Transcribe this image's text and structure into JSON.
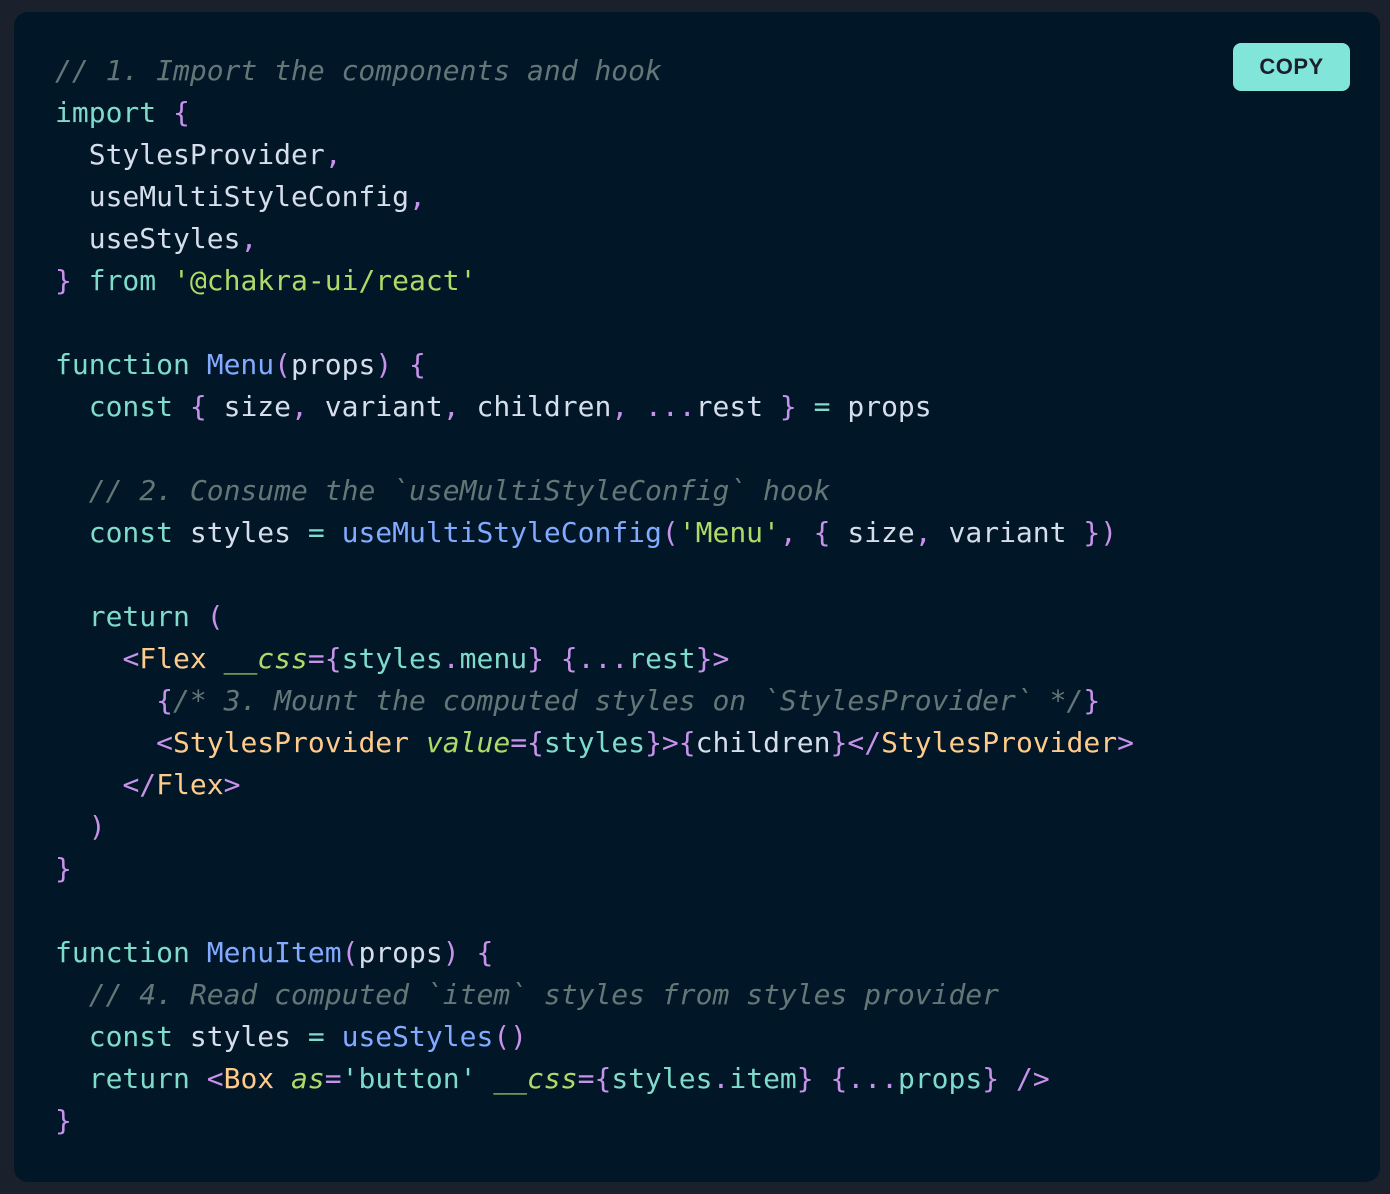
{
  "copy_button": {
    "label": "COPY"
  },
  "colors": {
    "background": "#011627",
    "comment": "#637777",
    "keyword": "#7fdbca",
    "punctuation": "#c792ea",
    "plain": "#d6deeb",
    "string": "#addb67",
    "function": "#82aaff",
    "tag": "#ffcb8b",
    "button": "#81e6d9"
  },
  "code_lines": [
    [
      [
        "comment",
        "// 1. Import the components and hook"
      ]
    ],
    [
      [
        "keyword",
        "import"
      ],
      [
        "plain",
        " "
      ],
      [
        "punct",
        "{"
      ]
    ],
    [
      [
        "plain",
        "  StylesProvider"
      ],
      [
        "punct",
        ","
      ]
    ],
    [
      [
        "plain",
        "  useMultiStyleConfig"
      ],
      [
        "punct",
        ","
      ]
    ],
    [
      [
        "plain",
        "  useStyles"
      ],
      [
        "punct",
        ","
      ]
    ],
    [
      [
        "punct",
        "}"
      ],
      [
        "plain",
        " "
      ],
      [
        "keyword",
        "from"
      ],
      [
        "plain",
        " "
      ],
      [
        "string",
        "'@chakra-ui/react'"
      ]
    ],
    [],
    [
      [
        "keyword",
        "function"
      ],
      [
        "plain",
        " "
      ],
      [
        "fn",
        "Menu"
      ],
      [
        "punct",
        "("
      ],
      [
        "plain",
        "props"
      ],
      [
        "punct",
        ")"
      ],
      [
        "plain",
        " "
      ],
      [
        "punct",
        "{"
      ]
    ],
    [
      [
        "plain",
        "  "
      ],
      [
        "keyword",
        "const"
      ],
      [
        "plain",
        " "
      ],
      [
        "punct",
        "{"
      ],
      [
        "plain",
        " size"
      ],
      [
        "punct",
        ","
      ],
      [
        "plain",
        " variant"
      ],
      [
        "punct",
        ","
      ],
      [
        "plain",
        " children"
      ],
      [
        "punct",
        ","
      ],
      [
        "plain",
        " "
      ],
      [
        "punct",
        "..."
      ],
      [
        "plain",
        "rest "
      ],
      [
        "punct",
        "}"
      ],
      [
        "plain",
        " "
      ],
      [
        "keyword",
        "="
      ],
      [
        "plain",
        " props"
      ]
    ],
    [],
    [
      [
        "plain",
        "  "
      ],
      [
        "comment",
        "// 2. Consume the `useMultiStyleConfig` hook"
      ]
    ],
    [
      [
        "plain",
        "  "
      ],
      [
        "keyword",
        "const"
      ],
      [
        "plain",
        " styles "
      ],
      [
        "keyword",
        "="
      ],
      [
        "plain",
        " "
      ],
      [
        "fn",
        "useMultiStyleConfig"
      ],
      [
        "punct",
        "("
      ],
      [
        "string",
        "'Menu'"
      ],
      [
        "punct",
        ","
      ],
      [
        "plain",
        " "
      ],
      [
        "punct",
        "{"
      ],
      [
        "plain",
        " size"
      ],
      [
        "punct",
        ","
      ],
      [
        "plain",
        " variant "
      ],
      [
        "punct",
        "})"
      ]
    ],
    [],
    [
      [
        "plain",
        "  "
      ],
      [
        "keyword",
        "return"
      ],
      [
        "plain",
        " "
      ],
      [
        "punct",
        "("
      ]
    ],
    [
      [
        "plain",
        "    "
      ],
      [
        "punct",
        "<"
      ],
      [
        "tag",
        "Flex"
      ],
      [
        "plain",
        " "
      ],
      [
        "attr",
        "__css"
      ],
      [
        "punct",
        "="
      ],
      [
        "punct",
        "{"
      ],
      [
        "prop",
        "styles"
      ],
      [
        "punct",
        "."
      ],
      [
        "prop",
        "menu"
      ],
      [
        "punct",
        "}"
      ],
      [
        "plain",
        " "
      ],
      [
        "punct",
        "{..."
      ],
      [
        "prop",
        "rest"
      ],
      [
        "punct",
        "}>"
      ]
    ],
    [
      [
        "plain",
        "      "
      ],
      [
        "punct",
        "{"
      ],
      [
        "comment",
        "/* 3. Mount the computed styles on `StylesProvider` */"
      ],
      [
        "punct",
        "}"
      ]
    ],
    [
      [
        "plain",
        "      "
      ],
      [
        "punct",
        "<"
      ],
      [
        "tag",
        "StylesProvider"
      ],
      [
        "plain",
        " "
      ],
      [
        "attr",
        "value"
      ],
      [
        "punct",
        "="
      ],
      [
        "punct",
        "{"
      ],
      [
        "prop",
        "styles"
      ],
      [
        "punct",
        "}>"
      ],
      [
        "punct",
        "{"
      ],
      [
        "plain",
        "children"
      ],
      [
        "punct",
        "}</"
      ],
      [
        "tag",
        "StylesProvider"
      ],
      [
        "punct",
        ">"
      ]
    ],
    [
      [
        "plain",
        "    "
      ],
      [
        "punct",
        "</"
      ],
      [
        "tag",
        "Flex"
      ],
      [
        "punct",
        ">"
      ]
    ],
    [
      [
        "plain",
        "  "
      ],
      [
        "punct",
        ")"
      ]
    ],
    [
      [
        "punct",
        "}"
      ]
    ],
    [],
    [
      [
        "keyword",
        "function"
      ],
      [
        "plain",
        " "
      ],
      [
        "fn",
        "MenuItem"
      ],
      [
        "punct",
        "("
      ],
      [
        "plain",
        "props"
      ],
      [
        "punct",
        ")"
      ],
      [
        "plain",
        " "
      ],
      [
        "punct",
        "{"
      ]
    ],
    [
      [
        "plain",
        "  "
      ],
      [
        "comment",
        "// 4. Read computed `item` styles from styles provider"
      ]
    ],
    [
      [
        "plain",
        "  "
      ],
      [
        "keyword",
        "const"
      ],
      [
        "plain",
        " styles "
      ],
      [
        "keyword",
        "="
      ],
      [
        "plain",
        " "
      ],
      [
        "fn",
        "useStyles"
      ],
      [
        "punct",
        "()"
      ]
    ],
    [
      [
        "plain",
        "  "
      ],
      [
        "keyword",
        "return"
      ],
      [
        "plain",
        " "
      ],
      [
        "punct",
        "<"
      ],
      [
        "tag",
        "Box"
      ],
      [
        "plain",
        " "
      ],
      [
        "attr",
        "as"
      ],
      [
        "punct",
        "="
      ],
      [
        "prop",
        "'button'"
      ],
      [
        "plain",
        " "
      ],
      [
        "attr",
        "__css"
      ],
      [
        "punct",
        "="
      ],
      [
        "punct",
        "{"
      ],
      [
        "prop",
        "styles"
      ],
      [
        "punct",
        "."
      ],
      [
        "prop",
        "item"
      ],
      [
        "punct",
        "}"
      ],
      [
        "plain",
        " "
      ],
      [
        "punct",
        "{..."
      ],
      [
        "prop",
        "props"
      ],
      [
        "punct",
        "}"
      ],
      [
        "plain",
        " "
      ],
      [
        "punct",
        "/>"
      ]
    ],
    [
      [
        "punct",
        "}"
      ]
    ]
  ]
}
